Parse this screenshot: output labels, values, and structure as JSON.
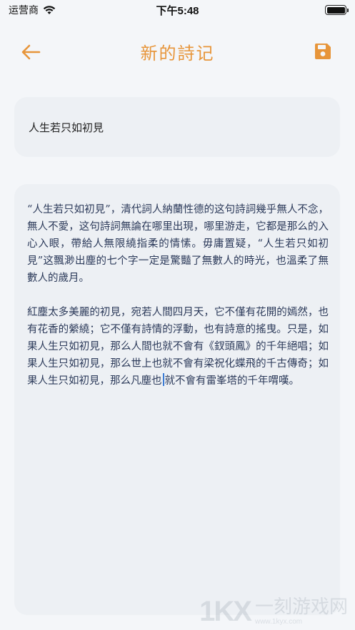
{
  "status_bar": {
    "carrier": "运营商",
    "time": "下午5:48"
  },
  "nav": {
    "title": "新的詩记",
    "back_icon": "arrow-left-icon",
    "save_icon": "floppy-disk-icon",
    "accent_color": "#e7953a"
  },
  "note": {
    "title": "人生若只如初見",
    "paragraphs": [
      "“人生若只如初見”，清代詞人納蘭性德的这句詩詞幾乎無人不念，無人不愛，这句詩詞無論在哪里出現，哪里游走，它都是那么的入心入眼，帶給人無限繞指柔的情愫。毋庸置疑，“人生若只如初見”这飄渺出塵的七个字一定是驚豔了無數人的時光，也溫柔了無數人的歲月。",
      "紅塵太多美麗的初見，宛若人間四月天，它不僅有花開的嫣然，也有花香的縈繞；它不僅有詩情的浮動，也有詩意的搖曳。只是，如果人生只如初見，那么人間也就不會有《釵頭鳳》的千年絕唱；如果人生只如初見，那么世上也就不會有梁祝化蝶飛的千古傳奇；如果人生只如初見，那么凡塵也就不會有雷峯塔的千年喟嘆。"
    ],
    "cursor_before": "只如初見，那么凡塵也",
    "cursor_after": "就不會有雷峯塔的千年喟嘆。"
  },
  "watermark": {
    "logo": "1KX",
    "text": "一刻游戏网",
    "url": "www.1kyx.com"
  }
}
